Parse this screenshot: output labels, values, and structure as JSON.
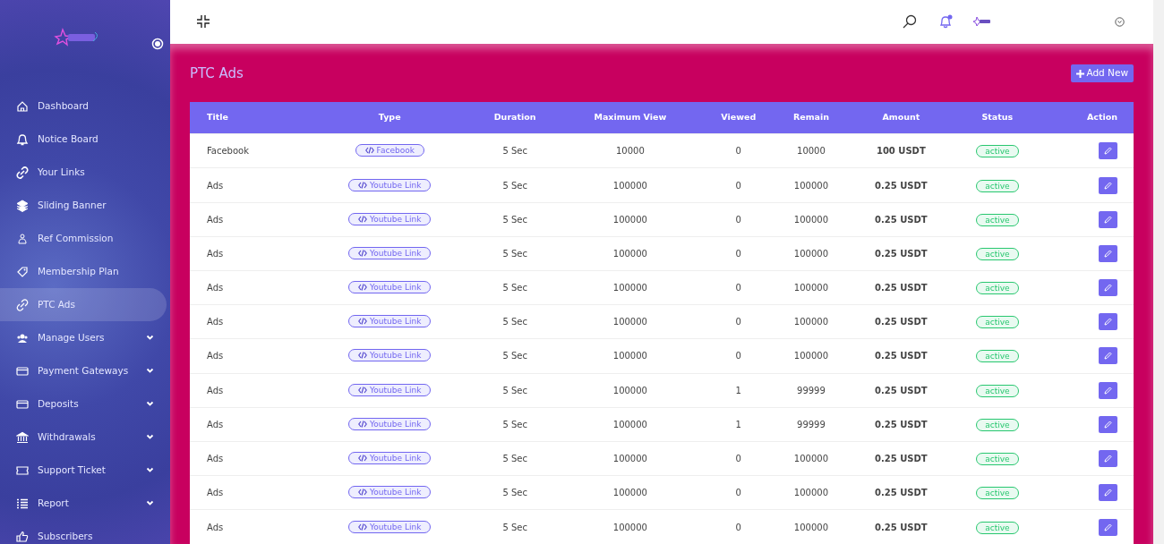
{
  "sidebar": {
    "items": [
      {
        "label": "Dashboard",
        "selected": false,
        "has_submenu": false
      },
      {
        "label": "Notice Board",
        "selected": false,
        "has_submenu": false
      },
      {
        "label": "Your Links",
        "selected": false,
        "has_submenu": false
      },
      {
        "label": "Sliding Banner",
        "selected": false,
        "has_submenu": false
      },
      {
        "label": "Ref Commission",
        "selected": false,
        "has_submenu": false
      },
      {
        "label": "Membership Plan",
        "selected": false,
        "has_submenu": false
      },
      {
        "label": "PTC Ads",
        "selected": true,
        "has_submenu": false
      },
      {
        "label": "Manage Users",
        "selected": false,
        "has_submenu": true
      },
      {
        "label": "Payment Gateways",
        "selected": false,
        "has_submenu": true
      },
      {
        "label": "Deposits",
        "selected": false,
        "has_submenu": true
      },
      {
        "label": "Withdrawals",
        "selected": false,
        "has_submenu": true
      },
      {
        "label": "Support Ticket",
        "selected": false,
        "has_submenu": true
      },
      {
        "label": "Report",
        "selected": false,
        "has_submenu": true
      },
      {
        "label": "Subscribers",
        "selected": false,
        "has_submenu": false
      }
    ]
  },
  "topbar": {
    "notification_unread": true
  },
  "page": {
    "title": "PTC Ads",
    "add_button": "Add New"
  },
  "table": {
    "columns": [
      "Title",
      "Type",
      "Duration",
      "Maximum View",
      "Viewed",
      "Remain",
      "Amount",
      "Status",
      "Action"
    ],
    "rows": [
      {
        "title": "Facebook",
        "type": "Facebook",
        "duration": "5 Sec",
        "max_view": "10000",
        "viewed": "0",
        "remain": "10000",
        "amount": "100 USDT",
        "status": "active"
      },
      {
        "title": "Ads",
        "type": "Youtube Link",
        "duration": "5 Sec",
        "max_view": "100000",
        "viewed": "0",
        "remain": "100000",
        "amount": "0.25 USDT",
        "status": "active"
      },
      {
        "title": "Ads",
        "type": "Youtube Link",
        "duration": "5 Sec",
        "max_view": "100000",
        "viewed": "0",
        "remain": "100000",
        "amount": "0.25 USDT",
        "status": "active"
      },
      {
        "title": "Ads",
        "type": "Youtube Link",
        "duration": "5 Sec",
        "max_view": "100000",
        "viewed": "0",
        "remain": "100000",
        "amount": "0.25 USDT",
        "status": "active"
      },
      {
        "title": "Ads",
        "type": "Youtube Link",
        "duration": "5 Sec",
        "max_view": "100000",
        "viewed": "0",
        "remain": "100000",
        "amount": "0.25 USDT",
        "status": "active"
      },
      {
        "title": "Ads",
        "type": "Youtube Link",
        "duration": "5 Sec",
        "max_view": "100000",
        "viewed": "0",
        "remain": "100000",
        "amount": "0.25 USDT",
        "status": "active"
      },
      {
        "title": "Ads",
        "type": "Youtube Link",
        "duration": "5 Sec",
        "max_view": "100000",
        "viewed": "0",
        "remain": "100000",
        "amount": "0.25 USDT",
        "status": "active"
      },
      {
        "title": "Ads",
        "type": "Youtube Link",
        "duration": "5 Sec",
        "max_view": "100000",
        "viewed": "1",
        "remain": "99999",
        "amount": "0.25 USDT",
        "status": "active"
      },
      {
        "title": "Ads",
        "type": "Youtube Link",
        "duration": "5 Sec",
        "max_view": "100000",
        "viewed": "1",
        "remain": "99999",
        "amount": "0.25 USDT",
        "status": "active"
      },
      {
        "title": "Ads",
        "type": "Youtube Link",
        "duration": "5 Sec",
        "max_view": "100000",
        "viewed": "0",
        "remain": "100000",
        "amount": "0.25 USDT",
        "status": "active"
      },
      {
        "title": "Ads",
        "type": "Youtube Link",
        "duration": "5 Sec",
        "max_view": "100000",
        "viewed": "0",
        "remain": "100000",
        "amount": "0.25 USDT",
        "status": "active"
      },
      {
        "title": "Ads",
        "type": "Youtube Link",
        "duration": "5 Sec",
        "max_view": "100000",
        "viewed": "0",
        "remain": "100000",
        "amount": "0.25 USDT",
        "status": "active"
      }
    ]
  }
}
